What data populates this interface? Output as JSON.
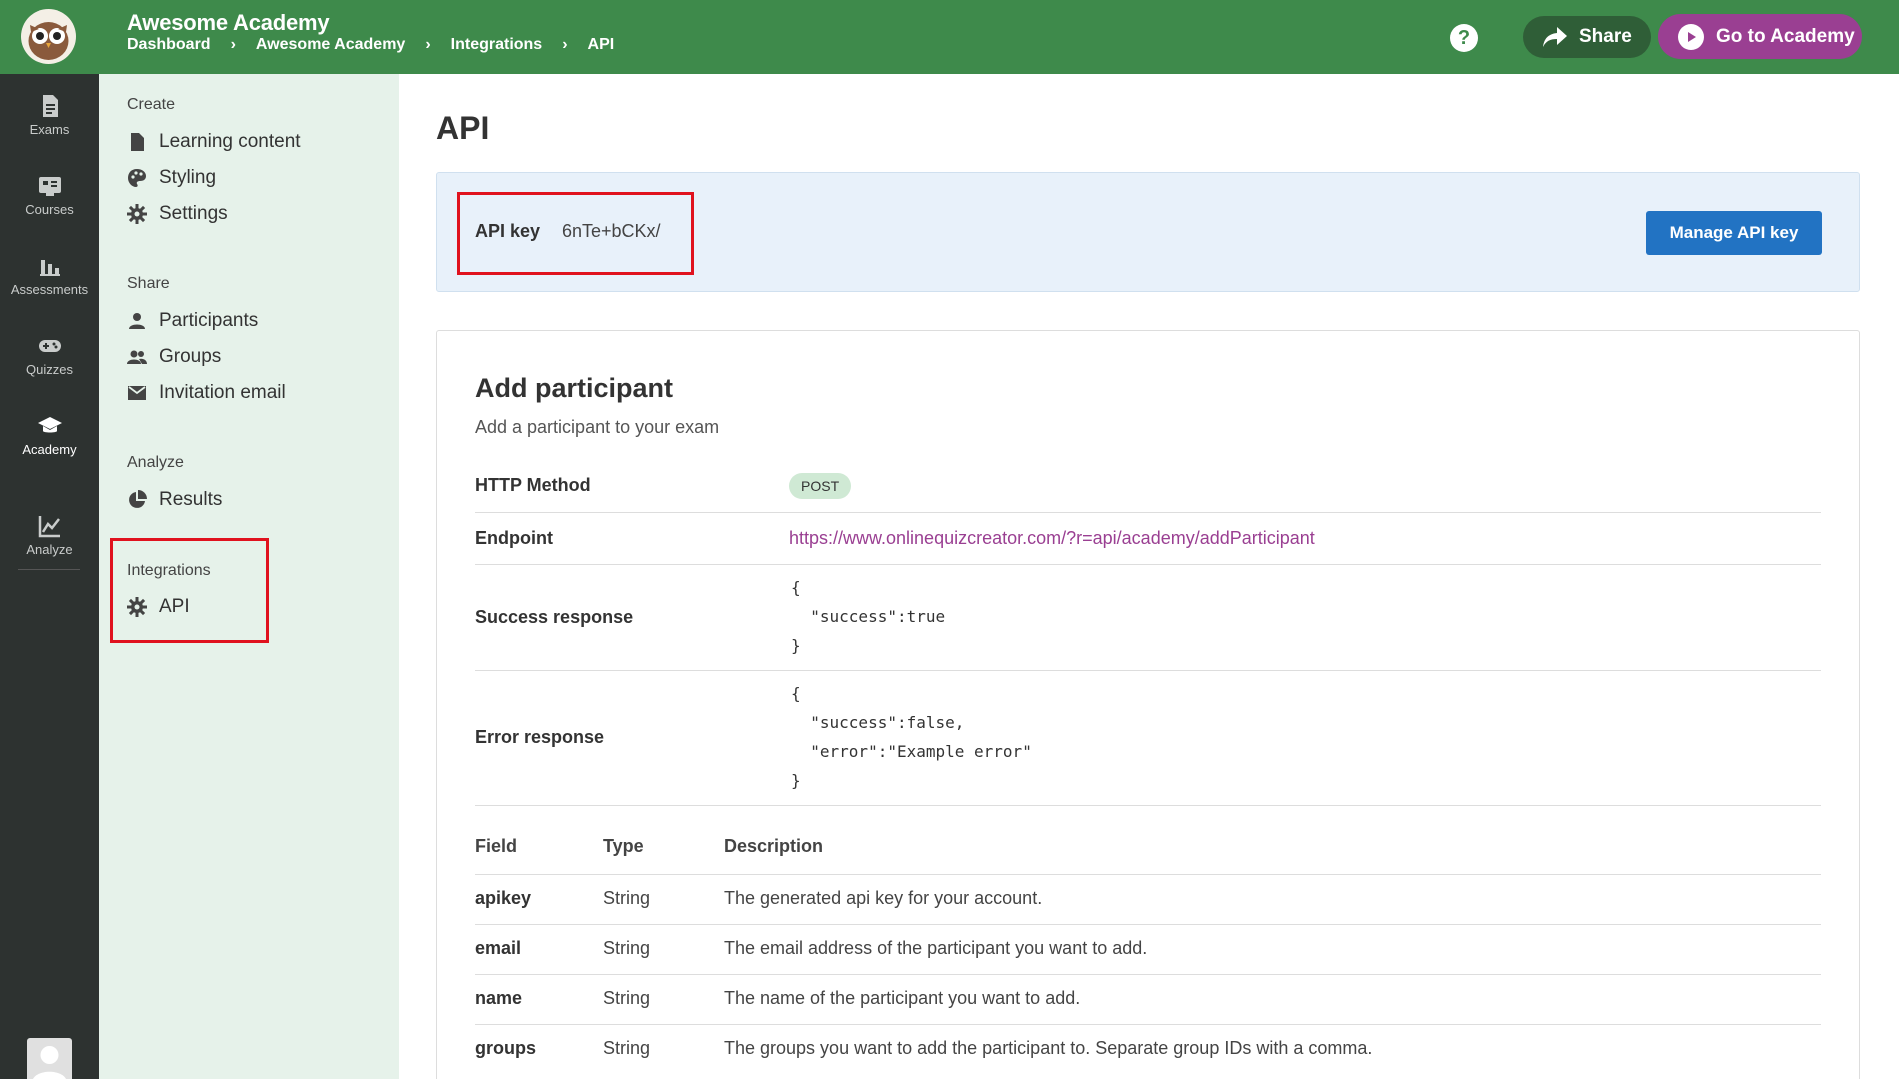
{
  "app": {
    "title": "Awesome Academy"
  },
  "breadcrumb": [
    "Dashboard",
    "Awesome Academy",
    "Integrations",
    "API"
  ],
  "header": {
    "help": "?",
    "share_label": "Share",
    "goto_label": "Go to Academy"
  },
  "rail": {
    "items": [
      {
        "label": "Exams",
        "icon": "document-icon"
      },
      {
        "label": "Courses",
        "icon": "courses-icon"
      },
      {
        "label": "Assessments",
        "icon": "bar-chart-icon"
      },
      {
        "label": "Quizzes",
        "icon": "gamepad-icon"
      },
      {
        "label": "Academy",
        "icon": "graduation-cap-icon",
        "active": true
      },
      {
        "label": "Analyze",
        "icon": "line-chart-icon"
      }
    ]
  },
  "sidebar": {
    "create_heading": "Create",
    "create_items": [
      "Learning content",
      "Styling",
      "Settings"
    ],
    "share_heading": "Share",
    "share_items": [
      "Participants",
      "Groups",
      "Invitation email"
    ],
    "analyze_heading": "Analyze",
    "analyze_items": [
      "Results"
    ],
    "integrations_heading": "Integrations",
    "integrations_items": [
      "API"
    ]
  },
  "main": {
    "title": "API",
    "api_key_label": "API key",
    "api_key_value": "6nTe+bCKx/",
    "manage_button": "Manage API key",
    "card": {
      "title": "Add participant",
      "subtitle": "Add a participant to your exam",
      "method_label": "HTTP Method",
      "method_value": "POST",
      "endpoint_label": "Endpoint",
      "endpoint_value": "https://www.onlinequizcreator.com/?r=api/academy/addParticipant",
      "success_label": "Success response",
      "success_value": "{\n  \"success\":true\n}",
      "error_label": "Error response",
      "error_value": "{\n  \"success\":false,\n  \"error\":\"Example error\"\n}",
      "table_headers": [
        "Field",
        "Type",
        "Description"
      ],
      "table_rows": [
        {
          "field": "apikey",
          "type": "String",
          "description": "The generated api key for your account."
        },
        {
          "field": "email",
          "type": "String",
          "description": "The email address of the participant you want to add."
        },
        {
          "field": "name",
          "type": "String",
          "description": "The name of the participant you want to add."
        },
        {
          "field": "groups",
          "type": "String",
          "description": "The groups you want to add the participant to. Separate group IDs with a comma."
        }
      ]
    }
  }
}
